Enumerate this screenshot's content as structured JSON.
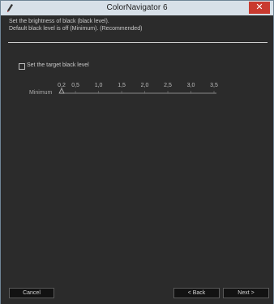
{
  "window": {
    "title": "ColorNavigator 6",
    "close_symbol": "✕",
    "icon": "pencil-app-icon"
  },
  "instructions": {
    "line1": "Set the brightness of black (black level).",
    "line2": "Default black level is off (Minimum). (Recommended)"
  },
  "target": {
    "checkbox_label": "Set the target black level",
    "checked": false
  },
  "slider": {
    "label": "Minimum",
    "ticks": [
      "0,2",
      "0,5",
      "1,0",
      "1,5",
      "2,0",
      "2,5",
      "3,0",
      "3,5"
    ],
    "tick_values": [
      0.2,
      0.5,
      1.0,
      1.5,
      2.0,
      2.5,
      3.0,
      3.5
    ],
    "value": "Minimum"
  },
  "buttons": {
    "cancel": "Cancel",
    "back": "< Back",
    "next": "Next >"
  },
  "colors": {
    "background": "#2b2b2b",
    "title_bar": "#d7e0e8",
    "close_button": "#c93a2f",
    "text": "#c9c9c9"
  }
}
